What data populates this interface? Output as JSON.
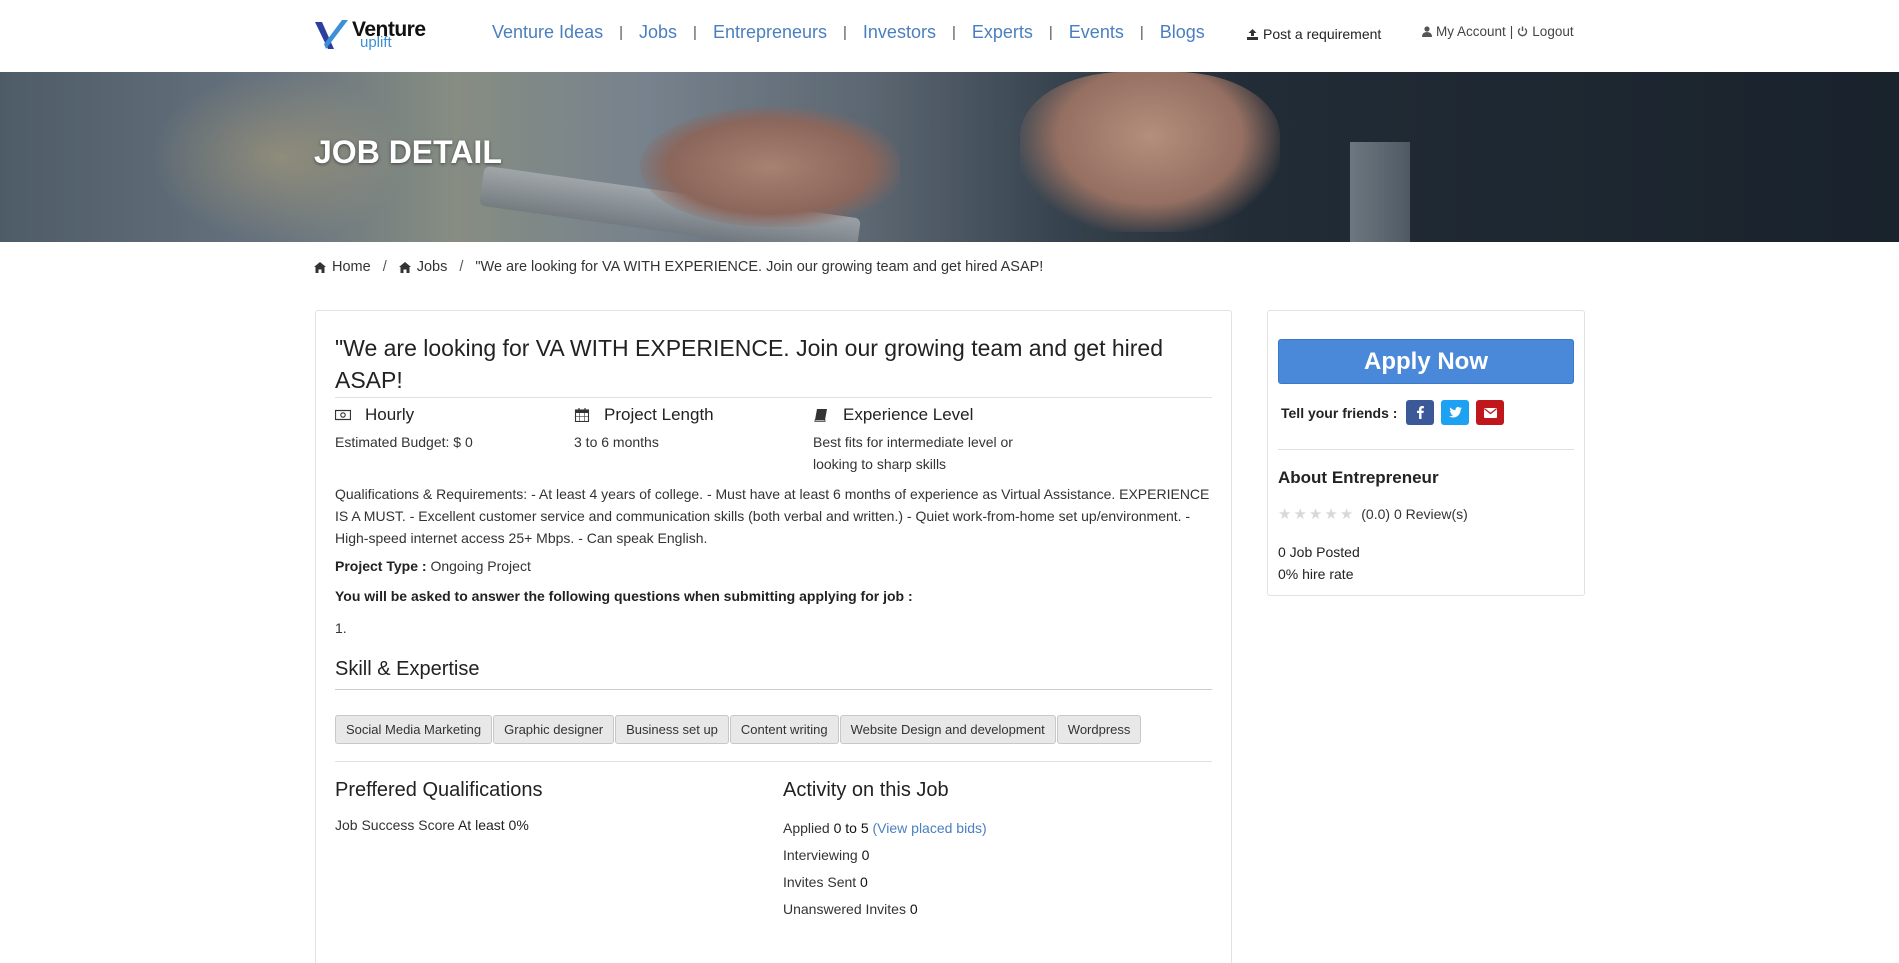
{
  "header": {
    "logo": {
      "line1": "Venture",
      "line2": "uplift"
    },
    "nav": [
      "Venture Ideas",
      "Jobs",
      "Entrepreneurs",
      "Investors",
      "Experts",
      "Events",
      "Blogs"
    ],
    "nav_separator": "|",
    "post_requirement": "Post a requirement",
    "my_account": "My Account",
    "account_separator": "|",
    "logout": "Logout"
  },
  "banner": {
    "title": "JOB DETAIL"
  },
  "breadcrumb": {
    "home": "Home",
    "jobs": "Jobs",
    "current": "\"We are looking for VA WITH EXPERIENCE. Join our growing team and get hired ASAP!",
    "separator": "/"
  },
  "job": {
    "title": "\"We are looking for VA WITH EXPERIENCE. Join our growing team and get hired ASAP!",
    "meta": [
      {
        "icon": "money-icon",
        "label": "Hourly",
        "value": "Estimated Budget: $ 0"
      },
      {
        "icon": "calendar-icon",
        "label": "Project Length",
        "value": "3 to 6 months"
      },
      {
        "icon": "book-icon",
        "label": "Experience Level",
        "value": "Best fits for intermediate level or looking to sharp skills"
      }
    ],
    "description": "Qualifications & Requirements: - At least 4 years of college. - Must have at least 6 months of experience as Virtual Assistance. EXPERIENCE IS A MUST. - Excellent customer service and communication skills (both verbal and written.) - Quiet work-from-home set up/environment. - High-speed internet access 25+ Mbps. - Can speak English.",
    "project_type_label": "Project Type :",
    "project_type_value": "Ongoing Project",
    "questions_heading": "You will be asked to answer the following questions when submitting applying for job :",
    "question_number": "1.",
    "skills_heading": "Skill & Expertise",
    "skills": [
      "Social Media Marketing",
      "Graphic designer",
      "Business set up",
      "Content writing",
      "Website Design and development",
      "Wordpress"
    ],
    "preferred": {
      "heading": "Preffered Qualifications",
      "label": "Job Success Score",
      "value": "At least 0%"
    },
    "activity": {
      "heading": "Activity on this Job",
      "applied_label": "Applied",
      "applied_value": "0 to 5",
      "view_bids": "(View placed bids)",
      "interviewing_label": "Interviewing",
      "interviewing_value": "0",
      "invites_label": "Invites Sent",
      "invites_value": "0",
      "unanswered_label": "Unanswered Invites",
      "unanswered_value": "0"
    }
  },
  "sidebar": {
    "apply": "Apply Now",
    "tell_friends": "Tell your friends :",
    "share_icons": [
      "facebook-icon",
      "twitter-icon",
      "email-icon"
    ],
    "about_heading": "About Entrepreneur",
    "rating": 0,
    "rating_text": "(0.0) 0 Review(s)",
    "jobs_posted": "0 Job Posted",
    "hire_rate": "0% hire rate"
  },
  "colors": {
    "accent": "#4a88d9",
    "link": "#4a7fbf",
    "facebook": "#3b5998",
    "twitter": "#1da1f2",
    "email": "#c0171c"
  }
}
